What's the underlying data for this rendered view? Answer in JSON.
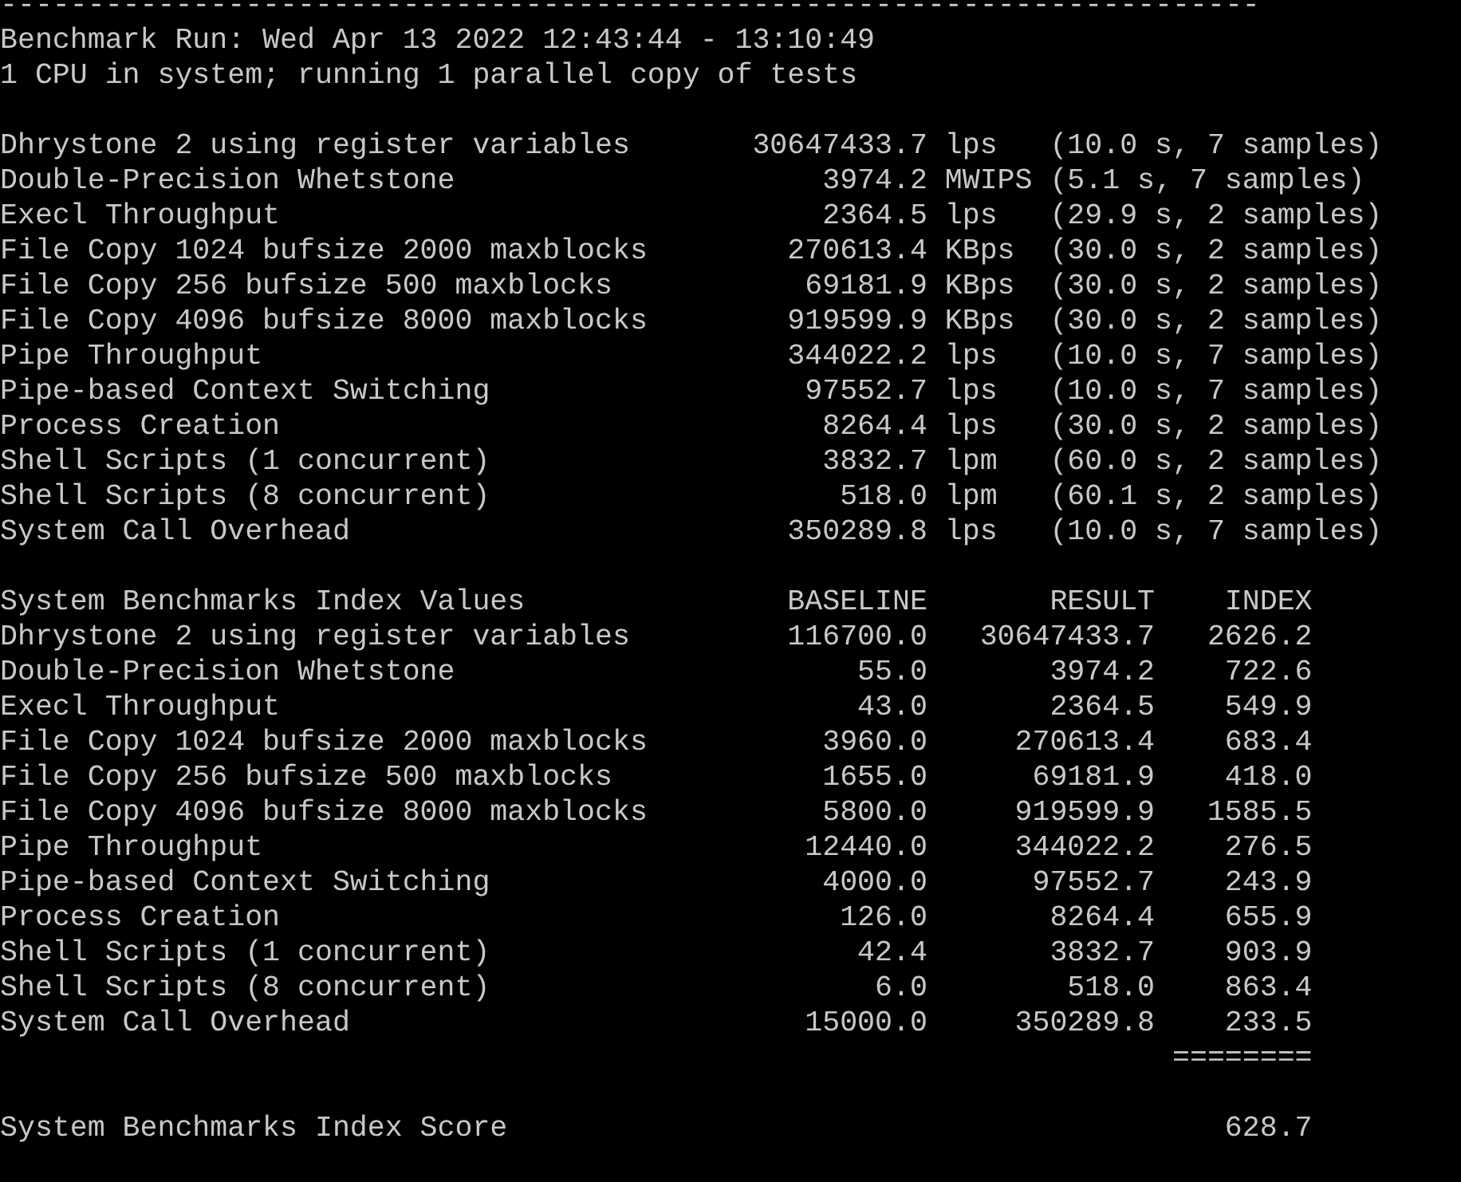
{
  "header": {
    "rule": "------------------------------------------------------------------------",
    "run": "Benchmark Run: Wed Apr 13 2022 12:43:44 - 13:10:49",
    "cpu": "1 CPU in system; running 1 parallel copy of tests"
  },
  "results": [
    {
      "test": "Dhrystone 2 using register variables",
      "score": "30647433.7",
      "unit": "lps",
      "detail": "(10.0 s, 7 samples)"
    },
    {
      "test": "Double-Precision Whetstone",
      "score": "3974.2",
      "unit": "MWIPS",
      "detail": "(5.1 s, 7 samples)"
    },
    {
      "test": "Execl Throughput",
      "score": "2364.5",
      "unit": "lps",
      "detail": "(29.9 s, 2 samples)"
    },
    {
      "test": "File Copy 1024 bufsize 2000 maxblocks",
      "score": "270613.4",
      "unit": "KBps",
      "detail": "(30.0 s, 2 samples)"
    },
    {
      "test": "File Copy 256 bufsize 500 maxblocks",
      "score": "69181.9",
      "unit": "KBps",
      "detail": "(30.0 s, 2 samples)"
    },
    {
      "test": "File Copy 4096 bufsize 8000 maxblocks",
      "score": "919599.9",
      "unit": "KBps",
      "detail": "(30.0 s, 2 samples)"
    },
    {
      "test": "Pipe Throughput",
      "score": "344022.2",
      "unit": "lps",
      "detail": "(10.0 s, 7 samples)"
    },
    {
      "test": "Pipe-based Context Switching",
      "score": "97552.7",
      "unit": "lps",
      "detail": "(10.0 s, 7 samples)"
    },
    {
      "test": "Process Creation",
      "score": "8264.4",
      "unit": "lps",
      "detail": "(30.0 s, 2 samples)"
    },
    {
      "test": "Shell Scripts (1 concurrent)",
      "score": "3832.7",
      "unit": "lpm",
      "detail": "(60.0 s, 2 samples)"
    },
    {
      "test": "Shell Scripts (8 concurrent)",
      "score": "518.0",
      "unit": "lpm",
      "detail": "(60.1 s, 2 samples)"
    },
    {
      "test": "System Call Overhead",
      "score": "350289.8",
      "unit": "lps",
      "detail": "(10.0 s, 7 samples)"
    }
  ],
  "index": {
    "title": "System Benchmarks Index Values",
    "columns": [
      "BASELINE",
      "RESULT",
      "INDEX"
    ],
    "rows": [
      {
        "test": "Dhrystone 2 using register variables",
        "baseline": "116700.0",
        "result": "30647433.7",
        "index": "2626.2"
      },
      {
        "test": "Double-Precision Whetstone",
        "baseline": "55.0",
        "result": "3974.2",
        "index": "722.6"
      },
      {
        "test": "Execl Throughput",
        "baseline": "43.0",
        "result": "2364.5",
        "index": "549.9"
      },
      {
        "test": "File Copy 1024 bufsize 2000 maxblocks",
        "baseline": "3960.0",
        "result": "270613.4",
        "index": "683.4"
      },
      {
        "test": "File Copy 256 bufsize 500 maxblocks",
        "baseline": "1655.0",
        "result": "69181.9",
        "index": "418.0"
      },
      {
        "test": "File Copy 4096 bufsize 8000 maxblocks",
        "baseline": "5800.0",
        "result": "919599.9",
        "index": "1585.5"
      },
      {
        "test": "Pipe Throughput",
        "baseline": "12440.0",
        "result": "344022.2",
        "index": "276.5"
      },
      {
        "test": "Pipe-based Context Switching",
        "baseline": "4000.0",
        "result": "97552.7",
        "index": "243.9"
      },
      {
        "test": "Process Creation",
        "baseline": "126.0",
        "result": "8264.4",
        "index": "655.9"
      },
      {
        "test": "Shell Scripts (1 concurrent)",
        "baseline": "42.4",
        "result": "3832.7",
        "index": "903.9"
      },
      {
        "test": "Shell Scripts (8 concurrent)",
        "baseline": "6.0",
        "result": "518.0",
        "index": "863.4"
      },
      {
        "test": "System Call Overhead",
        "baseline": "15000.0",
        "result": "350289.8",
        "index": "233.5"
      }
    ],
    "separator": "========"
  },
  "score": {
    "label": "System Benchmarks Index Score",
    "value": "628.7"
  }
}
